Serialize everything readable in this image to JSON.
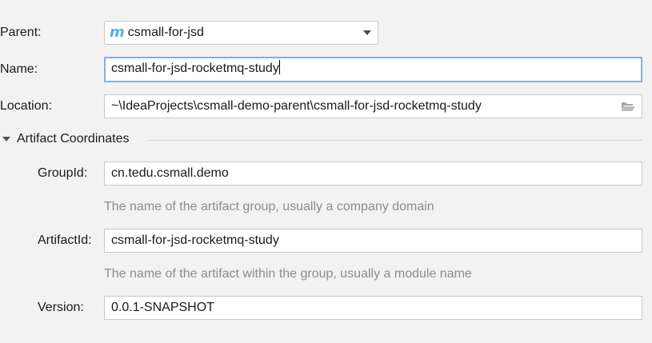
{
  "form": {
    "parent": {
      "label": "Parent:",
      "icon": "module-icon",
      "icon_glyph": "m",
      "value": "csmall-for-jsd"
    },
    "name": {
      "label": "Name:",
      "value": "csmall-for-jsd-rocketmq-study"
    },
    "location": {
      "label": "Location:",
      "value": "~\\IdeaProjects\\csmall-demo-parent\\csmall-for-jsd-rocketmq-study",
      "icon": "folder-open-icon"
    }
  },
  "artifact": {
    "title": "Artifact Coordinates",
    "group_id": {
      "label": "GroupId:",
      "value": "cn.tedu.csmall.demo",
      "hint": "The name of the artifact group, usually a company domain"
    },
    "artifact_id": {
      "label": "ArtifactId:",
      "value": "csmall-for-jsd-rocketmq-study",
      "hint": "The name of the artifact within the group, usually a module name"
    },
    "version": {
      "label": "Version:",
      "value": "0.0.1-SNAPSHOT"
    }
  },
  "colors": {
    "background": "#f2f2f2",
    "focus_border": "#86b0df",
    "module_icon": "#4fb5d8",
    "hint_text": "#8c8c8c"
  }
}
